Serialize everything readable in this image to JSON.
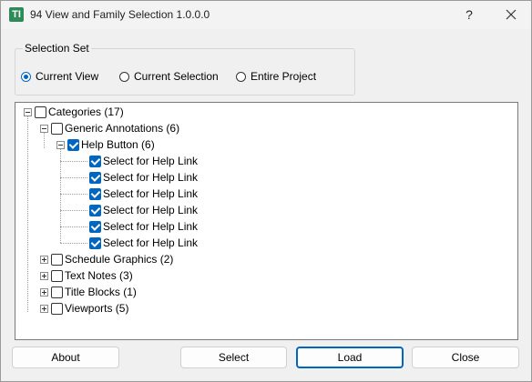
{
  "window": {
    "title": "94 View and Family Selection 1.0.0.0",
    "app_icon": "TI",
    "help_label": "?"
  },
  "selection_set": {
    "legend": "Selection Set",
    "options": [
      {
        "label": "Current View",
        "checked": true
      },
      {
        "label": "Current Selection",
        "checked": false
      },
      {
        "label": "Entire Project",
        "checked": false
      }
    ]
  },
  "tree": {
    "root": "Categories (17)",
    "generic_annotations": "Generic Annotations (6)",
    "help_button": "Help Button (6)",
    "leaf_label": "Select for Help Link",
    "leaves": [
      "Select for Help Link",
      "Select for Help Link",
      "Select for Help Link",
      "Select for Help Link",
      "Select for Help Link",
      "Select for Help Link"
    ],
    "collapsed": [
      "Schedule Graphics (2)",
      "Text Notes (3)",
      "Title Blocks (1)",
      "Viewports (5)"
    ]
  },
  "buttons": {
    "about": "About",
    "select": "Select",
    "load": "Load",
    "close": "Close"
  },
  "colors": {
    "accent": "#0067c0",
    "app_icon": "#2e8b57"
  }
}
